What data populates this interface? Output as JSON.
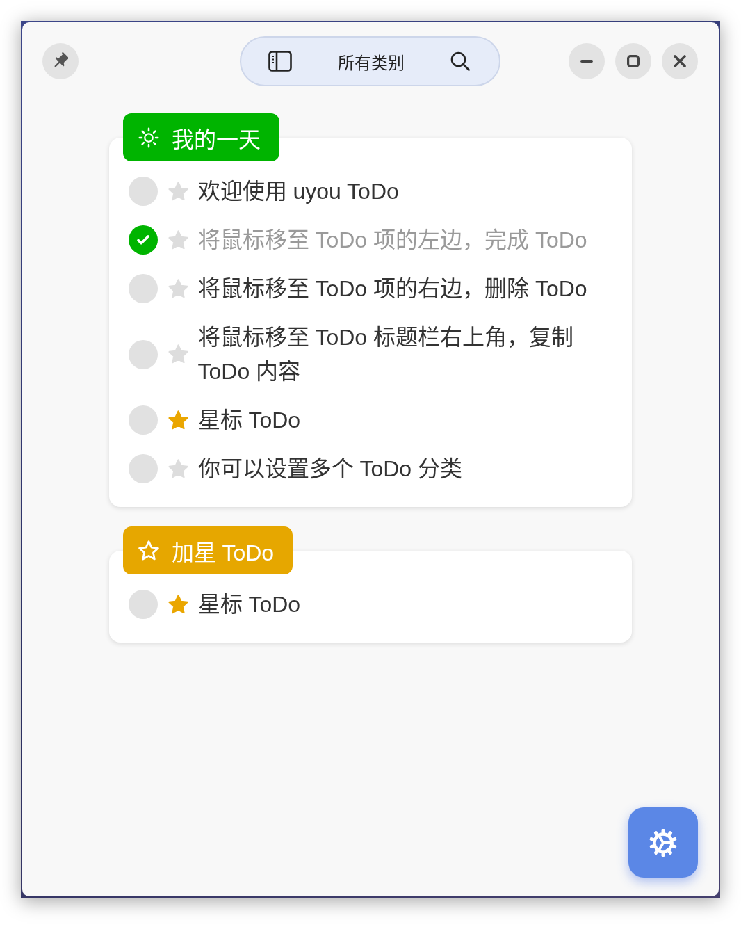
{
  "title_bar": {
    "category": "所有类别"
  },
  "lists": [
    {
      "kind": "my-day",
      "title": "我的一天",
      "color": "#00b400",
      "todos": [
        {
          "text": "欢迎使用 uyou ToDo",
          "checked": false,
          "starred": false
        },
        {
          "text": "将鼠标移至 ToDo 项的左边，完成 ToDo",
          "checked": true,
          "starred": false
        },
        {
          "text": "将鼠标移至 ToDo 项的右边，删除 ToDo",
          "checked": false,
          "starred": false
        },
        {
          "text": "将鼠标移至 ToDo 标题栏右上角，复制 ToDo 内容",
          "checked": false,
          "starred": false
        },
        {
          "text": "星标 ToDo",
          "checked": false,
          "starred": true
        },
        {
          "text": "你可以设置多个 ToDo 分类",
          "checked": false,
          "starred": false
        }
      ]
    },
    {
      "kind": "starred",
      "title": "加星 ToDo",
      "color": "#e6a700",
      "todos": [
        {
          "text": "星标 ToDo",
          "checked": false,
          "starred": true
        }
      ]
    }
  ]
}
